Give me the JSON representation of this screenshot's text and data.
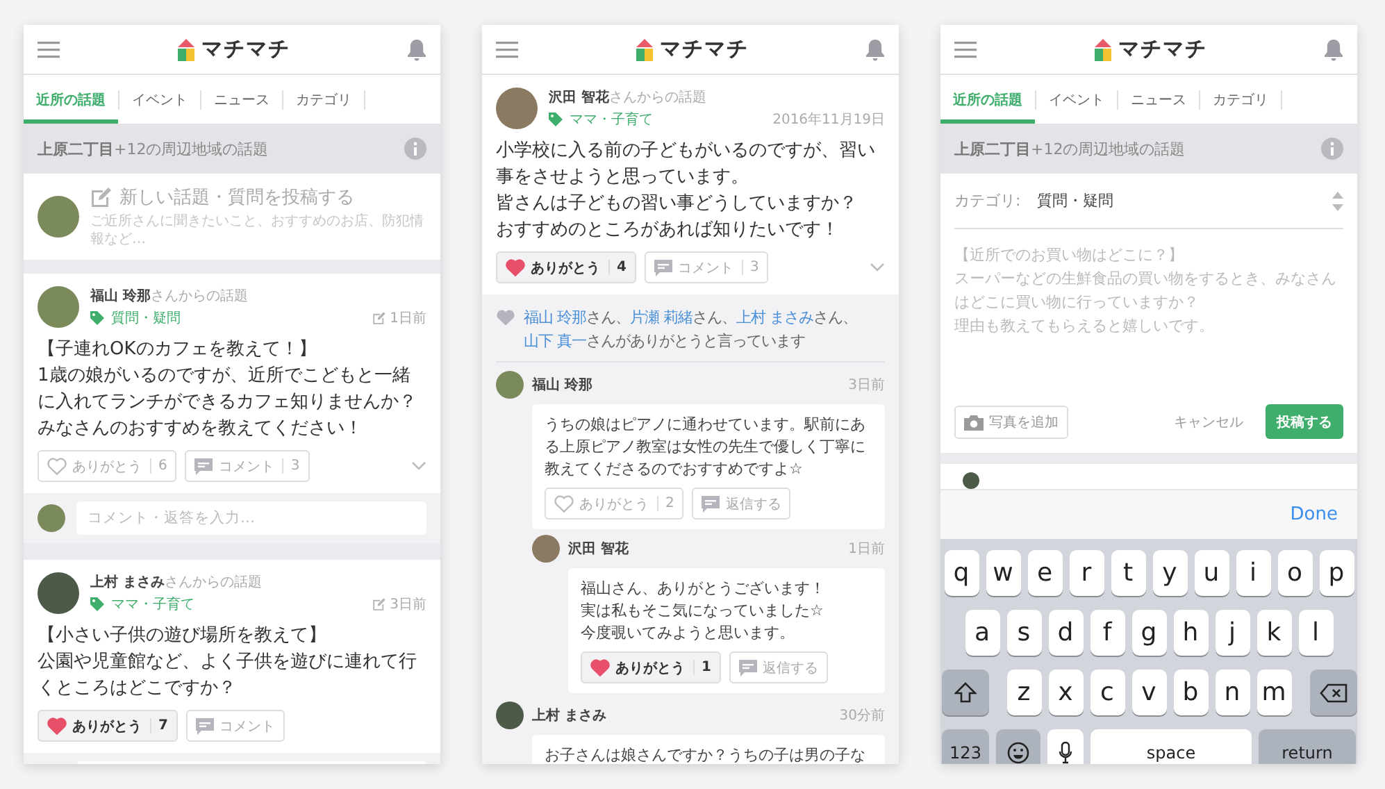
{
  "screens": [
    {
      "kind": "feed",
      "logo": "マチマチ",
      "tabs": [
        {
          "label": "近所の話題",
          "selected": true
        },
        {
          "label": "イベント",
          "selected": false
        },
        {
          "label": "ニュース",
          "selected": false
        },
        {
          "label": "カテゴリ",
          "selected": false
        }
      ],
      "area": "**上原二丁目**+12の周辺地域の話題",
      "composer": {
        "prompt": "新しい話題・質問を投稿する",
        "hint": "ご近所さんに聞きたいこと、おすすめのお店、防犯情報など…"
      },
      "posts": [
        {
          "byline": "**福山 玲那**さんからの話題",
          "tag": "質問・疑問",
          "time": "1日前",
          "edited": true,
          "body": [
            "【子連れOKのカフェを教えて！】",
            "1歳の娘がいるのですが、近所でこどもと一緒に入れてランチができるカフェ知りませんか？",
            "みなさんのおすすめを教えてください！"
          ],
          "thanks": {
            "label": "ありがとう",
            "count": "6",
            "liked": false
          },
          "comment": {
            "label": "コメント",
            "count": "3"
          },
          "expandable": true,
          "reply_placeholder": "コメント・返答を入力…"
        },
        {
          "byline": "**上村 まさみ**さんからの話題",
          "tag": "ママ・子育て",
          "time": "3日前",
          "edited": true,
          "body": [
            "【小さい子供の遊び場所を教えて】",
            "公園や児童館など、よく子供を遊びに連れて行くところはどこですか？"
          ],
          "thanks": {
            "label": "ありがとう",
            "count": "7",
            "liked": true
          },
          "comment": {
            "label": "コメント"
          },
          "expandable": false
        }
      ]
    },
    {
      "kind": "detail",
      "logo": "マチマチ",
      "post": {
        "byline": "**沢田 智花**さんからの話題",
        "tag": "ママ・子育て",
        "time": "2016年11月19日",
        "edited": false,
        "body": [
          "小学校に入る前の子どもがいるのですが、習い事をさせようと思っています。",
          "皆さんは子どもの習い事どうしていますか？",
          "おすすめのところがあれば知りたいです！"
        ],
        "thanks": {
          "label": "ありがとう",
          "count": "4",
          "liked": true
        },
        "comment": {
          "label": "コメント",
          "count": "3"
        },
        "expandable": true
      },
      "thanked_by": [
        {
          "kind": "link",
          "text": "福山 玲那"
        },
        {
          "kind": "text",
          "text": "さん、"
        },
        {
          "kind": "link",
          "text": "片瀬 莉緒"
        },
        {
          "kind": "text",
          "text": "さん、"
        },
        {
          "kind": "link",
          "text": "上村 まさみ"
        },
        {
          "kind": "text",
          "text": "さん、"
        },
        {
          "kind": "link",
          "text": "山下 真一"
        },
        {
          "kind": "text",
          "text": "さんがありがとうと言っています"
        }
      ],
      "comments": [
        {
          "author": "福山 玲那",
          "time": "3日前",
          "text": [
            "うちの娘はピアノに通わせています。駅前にある上原ピアノ教室は女性の先生で優しく丁寧に教えてくださるのでおすすめですよ☆"
          ],
          "thanks": {
            "label": "ありがとう",
            "count": "2",
            "liked": false
          },
          "reply": "返信する",
          "children": [
            {
              "author": "沢田 智花",
              "time": "1日前",
              "text": [
                "福山さん、ありがとうございます！",
                "実は私もそこ気になっていました☆",
                "今度覗いてみようと思います。"
              ],
              "thanks": {
                "label": "ありがとう",
                "count": "1",
                "liked": true
              },
              "reply": "返信する"
            }
          ]
        },
        {
          "author": "上村 まさみ",
          "time": "30分前",
          "text": [
            "お子さんは娘さんですか？うちの子は男の子な"
          ]
        }
      ]
    },
    {
      "kind": "compose",
      "logo": "マチマチ",
      "tabs": [
        {
          "label": "近所の話題",
          "selected": true
        },
        {
          "label": "イベント",
          "selected": false
        },
        {
          "label": "ニュース",
          "selected": false
        },
        {
          "label": "カテゴリ",
          "selected": false
        }
      ],
      "area": "**上原二丁目**+12の周辺地域の話題",
      "form": {
        "category_label": "カテゴリ:",
        "category_value": "質問・疑問",
        "placeholder": [
          "【近所でのお買い物はどこに？】",
          "スーパーなどの生鮮食品の買い物をするとき、みなさんはどこに買い物に行っていますか？",
          "理由も教えてもらえると嬉しいです。"
        ],
        "photo_button": "写真を追加",
        "cancel": "キャンセル",
        "submit": "投稿する"
      },
      "keyboard": {
        "done": "Done",
        "rows": [
          [
            "q",
            "w",
            "e",
            "r",
            "t",
            "y",
            "u",
            "i",
            "o",
            "p"
          ],
          [
            "a",
            "s",
            "d",
            "f",
            "g",
            "h",
            "j",
            "k",
            "l"
          ],
          [
            "z",
            "x",
            "c",
            "v",
            "b",
            "n",
            "m"
          ]
        ],
        "numbers_key": "123",
        "space_key": "space",
        "return_key": "return"
      }
    }
  ]
}
